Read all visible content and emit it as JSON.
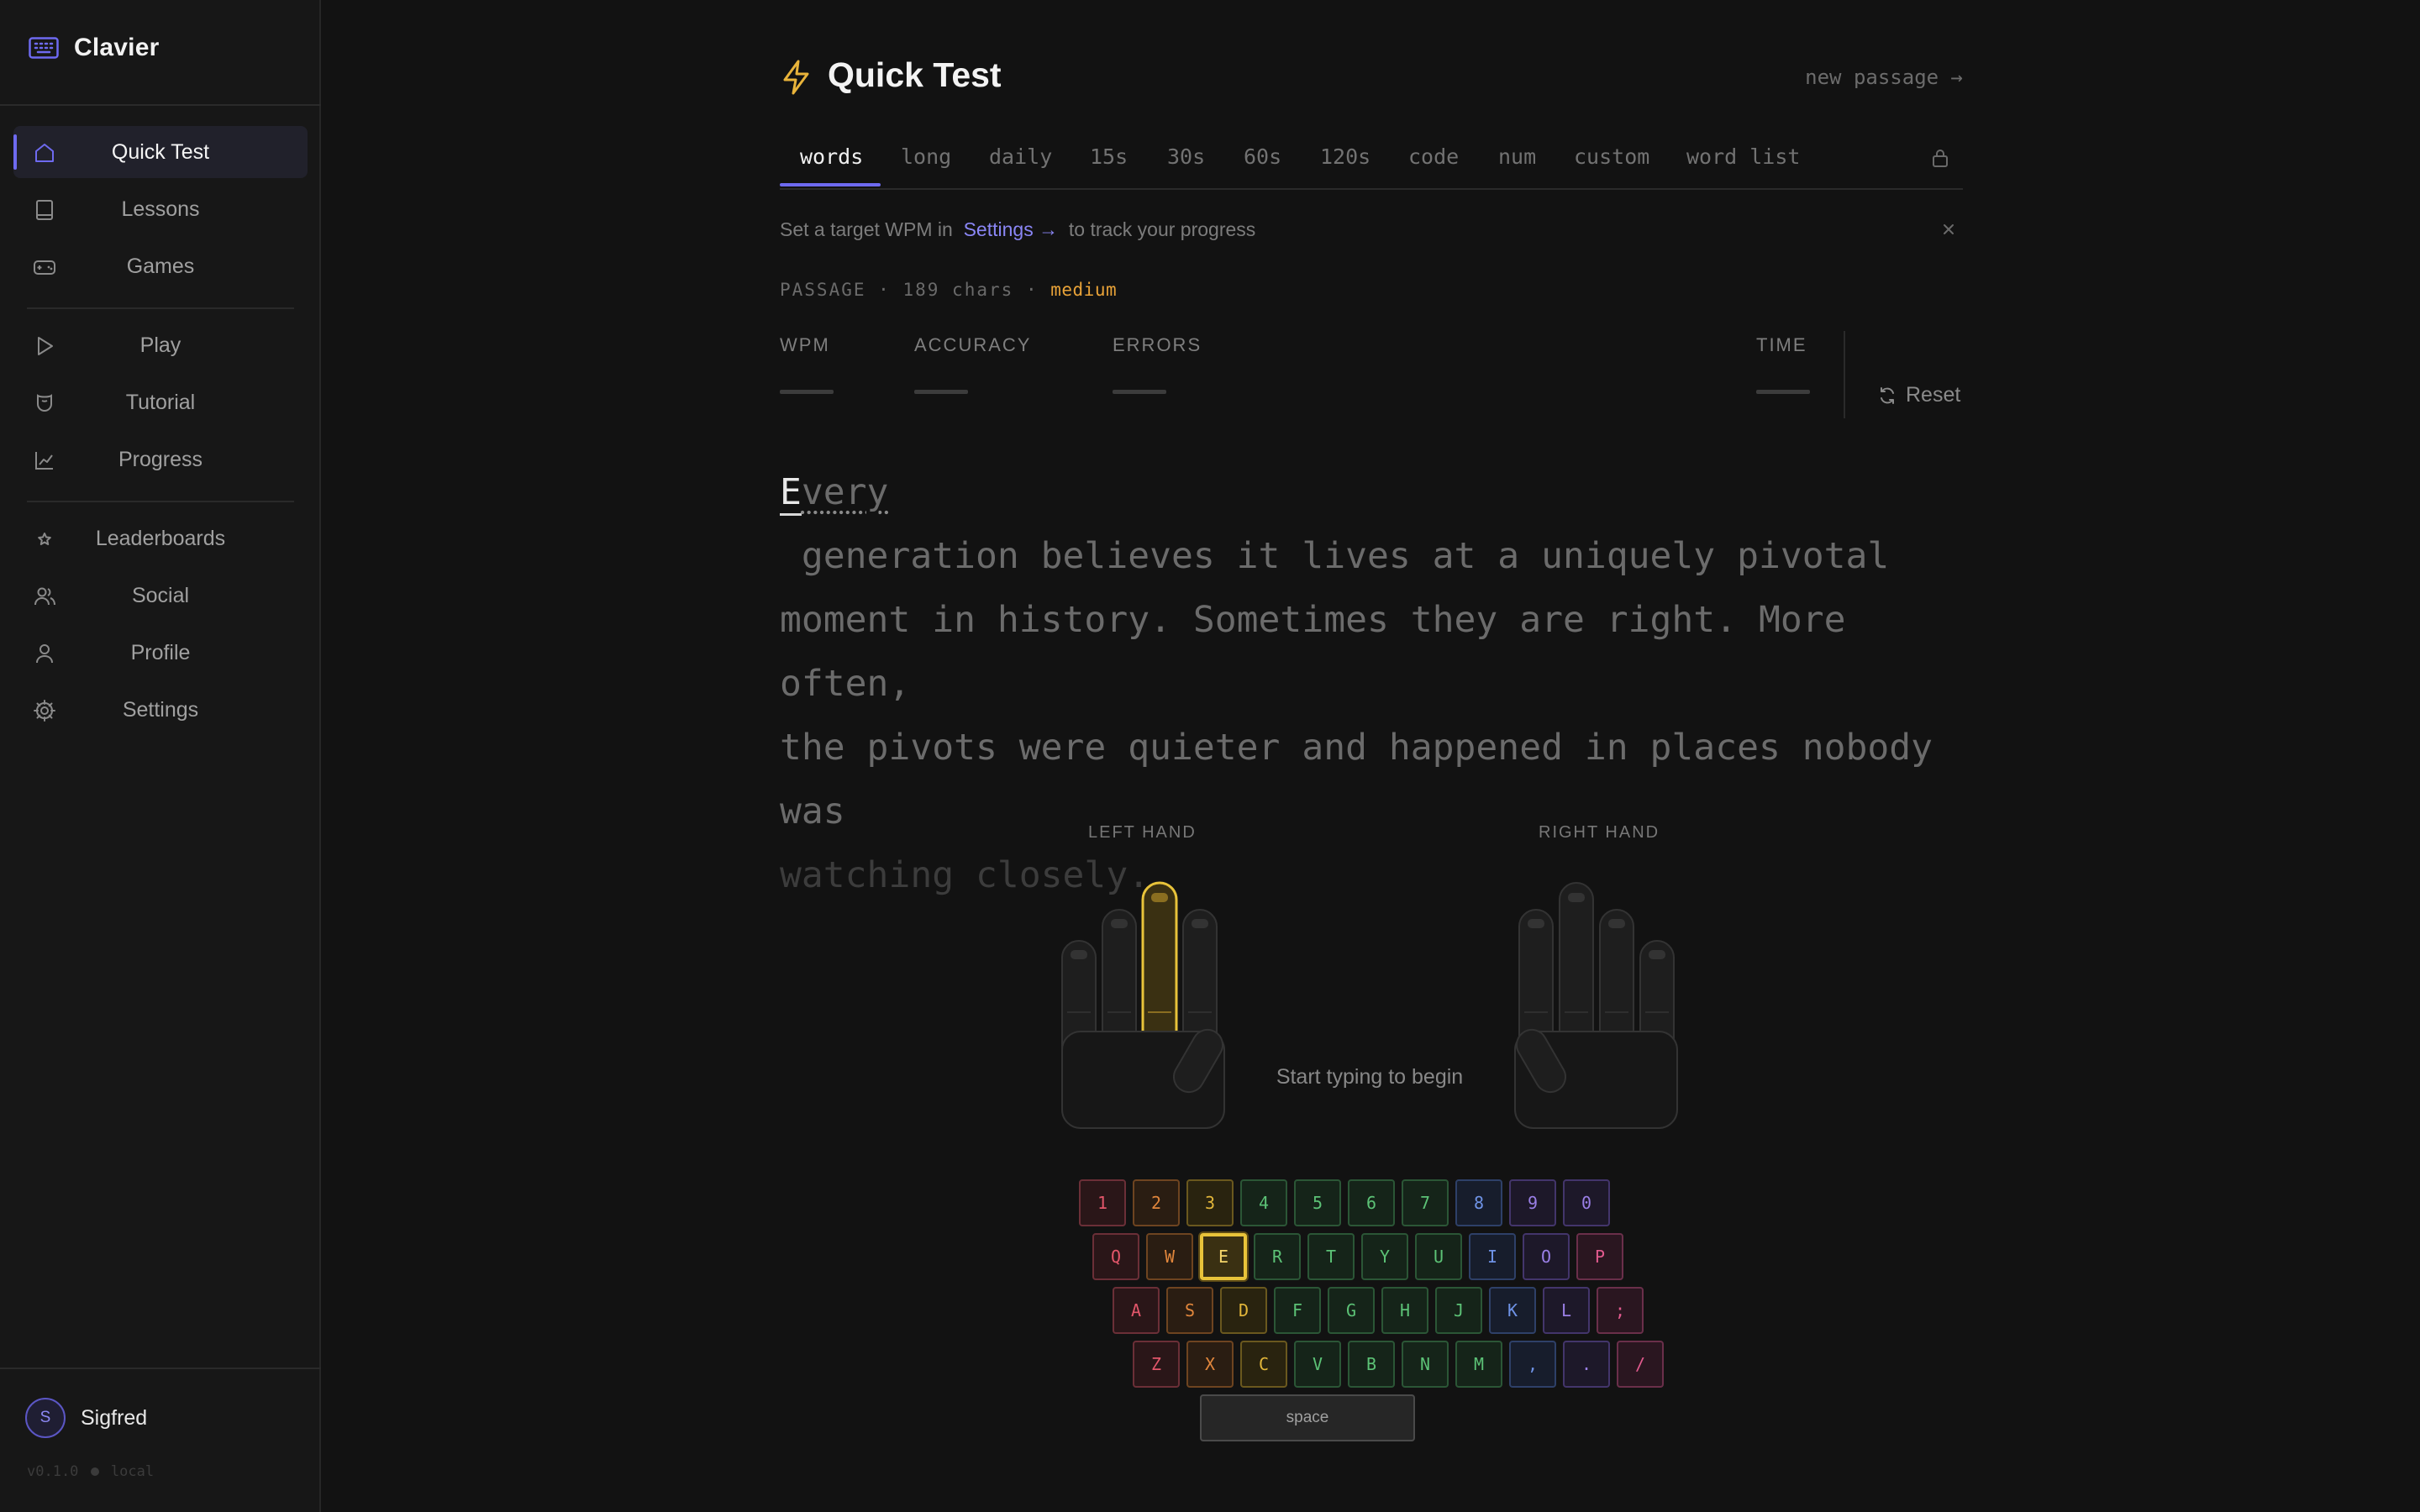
{
  "app": {
    "name": "Clavier",
    "version": "v0.1.0",
    "mode": "local"
  },
  "sidebar": {
    "items": [
      {
        "label": "Quick Test",
        "icon": "home-icon",
        "active": true
      },
      {
        "label": "Lessons",
        "icon": "book-icon"
      },
      {
        "label": "Games",
        "icon": "gamepad-icon"
      },
      {
        "label": "Play",
        "icon": "play-icon"
      },
      {
        "label": "Tutorial",
        "icon": "hand-icon"
      },
      {
        "label": "Progress",
        "icon": "chart-icon"
      },
      {
        "label": "Leaderboards",
        "icon": "star-icon"
      },
      {
        "label": "Social",
        "icon": "users-icon"
      },
      {
        "label": "Profile",
        "icon": "user-icon"
      },
      {
        "label": "Settings",
        "icon": "gear-icon"
      }
    ]
  },
  "user": {
    "initial": "S",
    "name": "Sigfred"
  },
  "header": {
    "title": "Quick Test",
    "new_passage": "new passage →"
  },
  "tabs": [
    "words",
    "long",
    "daily",
    "15s",
    "30s",
    "60s",
    "120s",
    "code",
    "num",
    "custom",
    "word list"
  ],
  "active_tab": "words",
  "notice": {
    "before": "Set a target WPM in",
    "link": "Settings →",
    "after": "to track your progress"
  },
  "passage_meta": {
    "label": "PASSAGE",
    "sep": "·",
    "chars": "189 chars",
    "difficulty": "medium"
  },
  "stats": {
    "wpm": "WPM",
    "accuracy": "ACCURACY",
    "errors": "ERRORS",
    "time": "TIME"
  },
  "reset_label": "Reset",
  "passage": {
    "cursor_char": "E",
    "current_word_rest": "very",
    "line1_rest": " generation believes it lives at a uniquely pivotal",
    "line2": "moment in history. Sometimes they are right. More often,",
    "line3": "the pivots were quieter and happened in places nobody was",
    "line4": "watching closely."
  },
  "hands": {
    "left_label": "LEFT HAND",
    "right_label": "RIGHT HAND",
    "hint": "Start typing to begin"
  },
  "keyboard": {
    "rows": [
      [
        "1",
        "2",
        "3",
        "4",
        "5",
        "6",
        "7",
        "8",
        "9",
        "0"
      ],
      [
        "Q",
        "W",
        "E",
        "R",
        "T",
        "Y",
        "U",
        "I",
        "O",
        "P"
      ],
      [
        "A",
        "S",
        "D",
        "F",
        "G",
        "H",
        "J",
        "K",
        "L",
        ";"
      ],
      [
        "Z",
        "X",
        "C",
        "V",
        "B",
        "N",
        "M",
        ",",
        ".",
        "/"
      ]
    ],
    "space": "space",
    "active_key": "E"
  },
  "colors": {
    "accent": "#6e6af0",
    "highlight": "#e8c33a",
    "difficulty": "#e8a238"
  }
}
